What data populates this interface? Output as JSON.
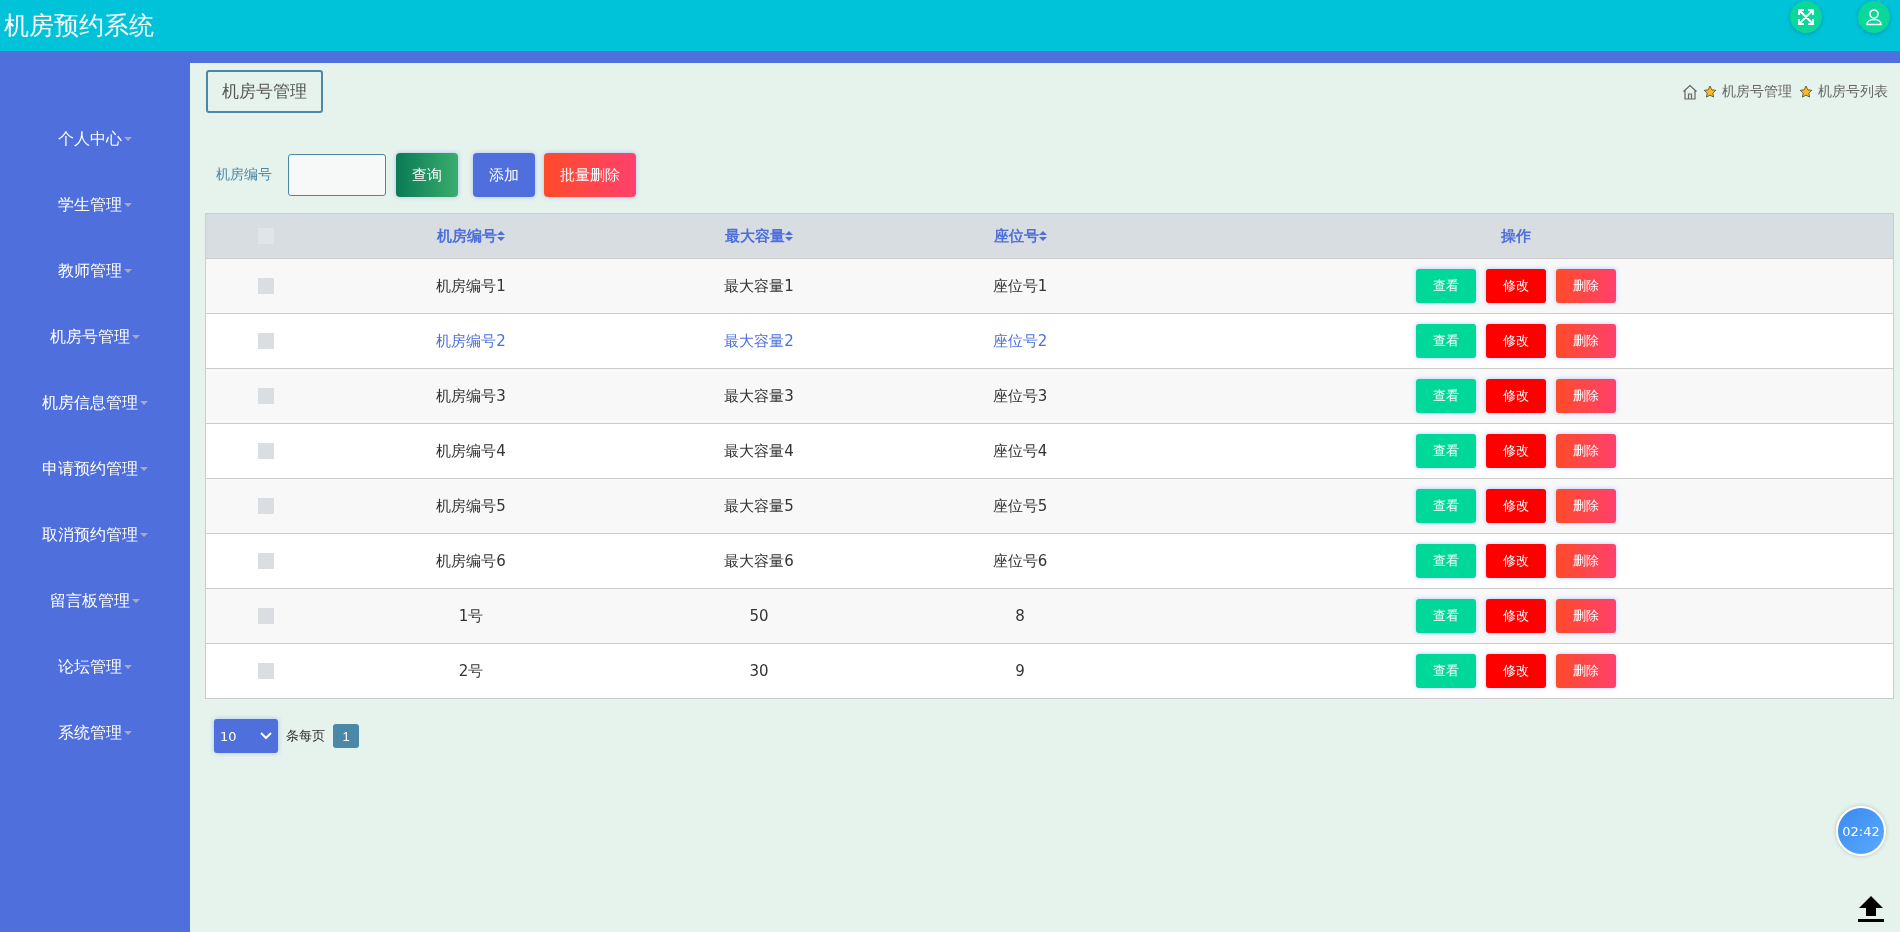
{
  "header": {
    "title": "机房预约系统"
  },
  "sidebar": {
    "items": [
      {
        "label": "个人中心"
      },
      {
        "label": "学生管理"
      },
      {
        "label": "教师管理"
      },
      {
        "label": "机房号管理"
      },
      {
        "label": "机房信息管理"
      },
      {
        "label": "申请预约管理"
      },
      {
        "label": "取消预约管理"
      },
      {
        "label": "留言板管理"
      },
      {
        "label": "论坛管理"
      },
      {
        "label": "系统管理"
      }
    ]
  },
  "page_title": "机房号管理",
  "breadcrumb": [
    "机房号管理",
    "机房号列表"
  ],
  "search": {
    "label": "机房编号",
    "query_button": "查询",
    "add_button": "添加",
    "batch_delete_button": "批量删除"
  },
  "table": {
    "select_all_checked": false,
    "columns": [
      "机房编号",
      "最大容量",
      "座位号",
      "操作"
    ],
    "rows": [
      {
        "cells": [
          "机房编号1",
          "最大容量1",
          "座位号1"
        ],
        "actions": [
          "查看",
          "修改",
          "删除"
        ],
        "checked": false,
        "hovered": false
      },
      {
        "cells": [
          "机房编号2",
          "最大容量2",
          "座位号2"
        ],
        "actions": [
          "查看",
          "修改",
          "删除"
        ],
        "checked": false,
        "hovered": true
      },
      {
        "cells": [
          "机房编号3",
          "最大容量3",
          "座位号3"
        ],
        "actions": [
          "查看",
          "修改",
          "删除"
        ],
        "checked": false,
        "hovered": false
      },
      {
        "cells": [
          "机房编号4",
          "最大容量4",
          "座位号4"
        ],
        "actions": [
          "查看",
          "修改",
          "删除"
        ],
        "checked": false,
        "hovered": false
      },
      {
        "cells": [
          "机房编号5",
          "最大容量5",
          "座位号5"
        ],
        "actions": [
          "查看",
          "修改",
          "删除"
        ],
        "checked": false,
        "hovered": false
      },
      {
        "cells": [
          "机房编号6",
          "最大容量6",
          "座位号6"
        ],
        "actions": [
          "查看",
          "修改",
          "删除"
        ],
        "checked": false,
        "hovered": false
      },
      {
        "cells": [
          "1号",
          "50",
          "8"
        ],
        "actions": [
          "查看",
          "修改",
          "删除"
        ],
        "checked": false,
        "hovered": false
      },
      {
        "cells": [
          "2号",
          "30",
          "9"
        ],
        "actions": [
          "查看",
          "修改",
          "删除"
        ],
        "checked": false,
        "hovered": false
      }
    ]
  },
  "pagination": {
    "page_size": "10",
    "per_page_label": "条每页",
    "pages": [
      {
        "label": "1",
        "selected": true
      }
    ]
  },
  "clock": "02:42"
}
